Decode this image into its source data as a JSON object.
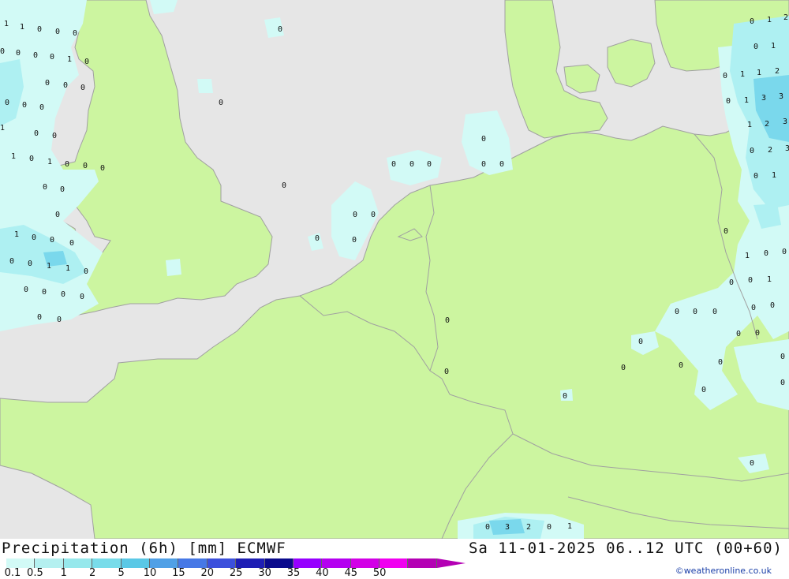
{
  "header": {
    "title": "Precipitation (6h) [mm] ECMWF",
    "datetime": "Sa 11-01-2025 06..12 UTC (00+60)"
  },
  "legend": {
    "ticks": [
      "0.1",
      "0.5",
      "1",
      "2",
      "5",
      "10",
      "15",
      "20",
      "25",
      "30",
      "35",
      "40",
      "45",
      "50"
    ],
    "colors": [
      "#d2faf6",
      "#b4f0f0",
      "#96e8ec",
      "#78dcea",
      "#5ac8e6",
      "#50a0e6",
      "#4678e6",
      "#3c50dc",
      "#1e1eb4",
      "#0a0a8c",
      "#9600ff",
      "#b400f0",
      "#d200e6",
      "#f000f0",
      "#b400b4"
    ]
  },
  "credit": "©weatheronline.co.uk",
  "map": {
    "colors": {
      "sea": "#e6e6e6",
      "land": "#ccf5a0",
      "precip_light": "#d2faf6",
      "precip_mid": "#aef0f2",
      "precip_heavy": "#7ad8ec",
      "border": "#a0a0a0"
    },
    "value_labels": [
      "0",
      "1",
      "2",
      "3"
    ]
  }
}
